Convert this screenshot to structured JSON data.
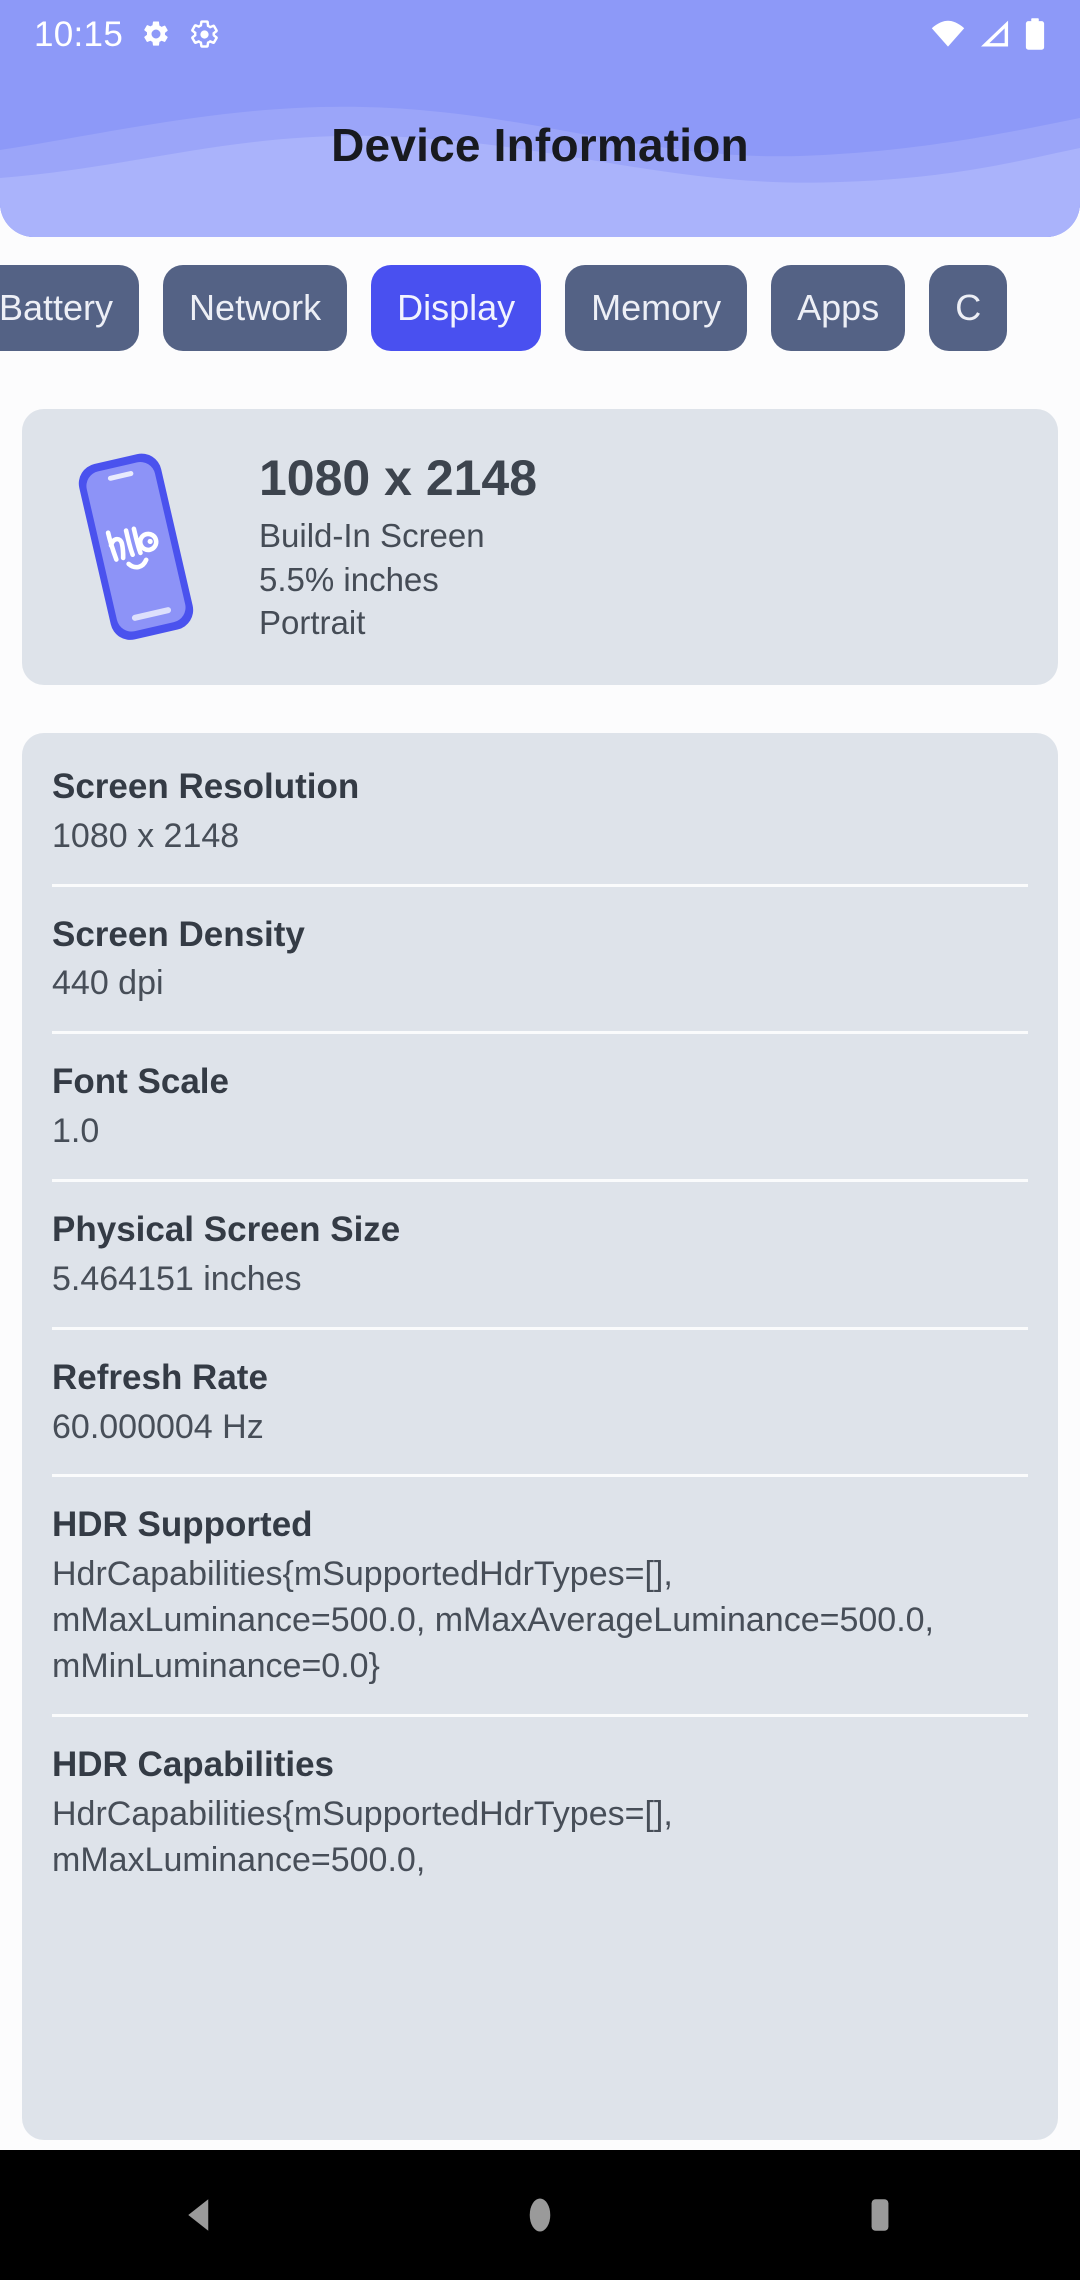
{
  "statusbar": {
    "time": "10:15",
    "icons": [
      "gear-filled-icon",
      "gear-outline-icon",
      "wifi-icon",
      "cellular-signal-icon",
      "battery-icon"
    ]
  },
  "header": {
    "title": "Device Information"
  },
  "tabs": [
    {
      "label": "Battery",
      "selected": false
    },
    {
      "label": "Network",
      "selected": false
    },
    {
      "label": "Display",
      "selected": true
    },
    {
      "label": "Memory",
      "selected": false
    },
    {
      "label": "Apps",
      "selected": false
    },
    {
      "label": "C",
      "selected": false
    }
  ],
  "device_card": {
    "illustration_text": "hello",
    "resolution": "1080 x 2148",
    "screen_type": "Build-In Screen",
    "size": "5.5% inches",
    "orientation": "Portrait"
  },
  "info_rows": [
    {
      "label": "Screen Resolution",
      "value": "1080 x 2148"
    },
    {
      "label": "Screen Density",
      "value": "440 dpi"
    },
    {
      "label": "Font Scale",
      "value": "1.0"
    },
    {
      "label": "Physical Screen Size",
      "value": "5.464151 inches"
    },
    {
      "label": "Refresh Rate",
      "value": "60.000004 Hz"
    },
    {
      "label": "HDR Supported",
      "value": "HdrCapabilities{mSupportedHdrTypes=[], mMaxLuminance=500.0, mMaxAverageLuminance=500.0, mMinLuminance=0.0}"
    },
    {
      "label": "HDR Capabilities",
      "value": "HdrCapabilities{mSupportedHdrTypes=[], mMaxLuminance=500.0,"
    }
  ],
  "navbar": {
    "back": "back-icon",
    "home": "home-icon",
    "recents": "recents-icon"
  },
  "colors": {
    "header_top": "#8D99F8",
    "header_bottom": "#AAB3FB",
    "tab_inactive": "#546285",
    "tab_active": "#4950F0",
    "card_bg": "#DEE3EA",
    "page_bg": "#FCFCFD",
    "text_dark": "#343B45",
    "navbar_bg": "#000000"
  }
}
